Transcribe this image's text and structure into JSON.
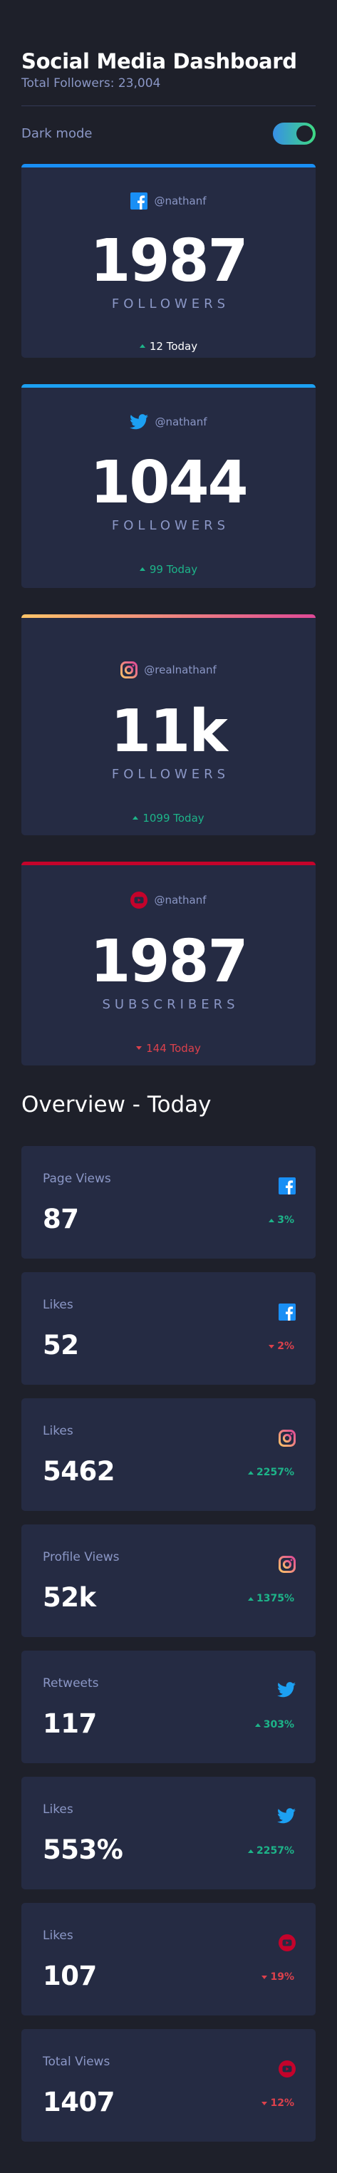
{
  "header": {
    "title": "Social Media Dashboard",
    "total_followers": "Total Followers: 23,004",
    "dark_mode_label": "Dark mode",
    "dark_mode_on": true
  },
  "colors": {
    "facebook": "#198ff5",
    "twitter": "#1ca0f2",
    "instagram_gradient": [
      "#fdc468",
      "#df4996"
    ],
    "youtube": "#c4032b",
    "up": "#1db489",
    "down": "#dc414c"
  },
  "follower_cards": [
    {
      "platform": "facebook",
      "icon": "facebook-icon",
      "handle": "@nathanf",
      "count": "1987",
      "metric": "FOLLOWERS",
      "delta": "12 Today",
      "trend": "up"
    },
    {
      "platform": "twitter",
      "icon": "twitter-icon",
      "handle": "@nathanf",
      "count": "1044",
      "metric": "FOLLOWERS",
      "delta": "99 Today",
      "trend": "up"
    },
    {
      "platform": "instagram",
      "icon": "instagram-icon",
      "handle": "@realnathanf",
      "count": "11k",
      "metric": "FOLLOWERS",
      "delta": "1099 Today",
      "trend": "up"
    },
    {
      "platform": "youtube",
      "icon": "youtube-icon",
      "handle": "@nathanf",
      "count": "1987",
      "metric": "SUBSCRIBERS",
      "delta": "144 Today",
      "trend": "down"
    }
  ],
  "overview": {
    "title": "Overview - Today",
    "cards": [
      {
        "label": "Page Views",
        "value": "87",
        "icon": "facebook-icon",
        "pct": "3%",
        "trend": "up"
      },
      {
        "label": "Likes",
        "value": "52",
        "icon": "facebook-icon",
        "pct": "2%",
        "trend": "down"
      },
      {
        "label": "Likes",
        "value": "5462",
        "icon": "instagram-icon",
        "pct": "2257%",
        "trend": "up"
      },
      {
        "label": "Profile Views",
        "value": "52k",
        "icon": "instagram-icon",
        "pct": "1375%",
        "trend": "up"
      },
      {
        "label": "Retweets",
        "value": "117",
        "icon": "twitter-icon",
        "pct": "303%",
        "trend": "up"
      },
      {
        "label": "Likes",
        "value": "553%",
        "icon": "twitter-icon",
        "pct": "2257%",
        "trend": "up"
      },
      {
        "label": "Likes",
        "value": "107",
        "icon": "youtube-icon",
        "pct": "19%",
        "trend": "down"
      },
      {
        "label": "Total Views",
        "value": "1407",
        "icon": "youtube-icon",
        "pct": "12%",
        "trend": "down"
      }
    ]
  }
}
